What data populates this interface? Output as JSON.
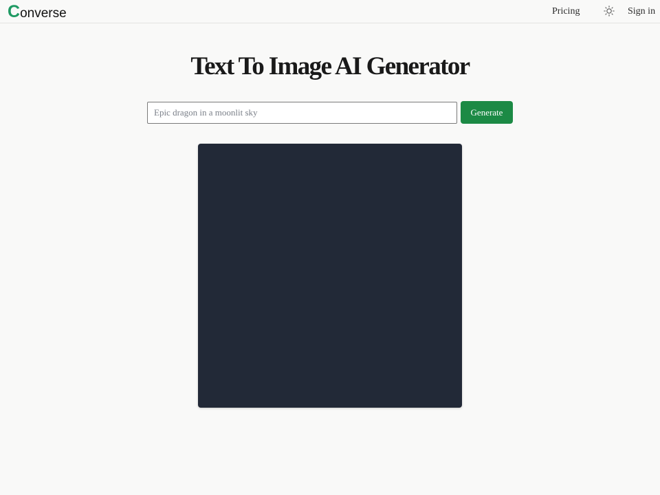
{
  "header": {
    "logo": {
      "mark": "C",
      "rest": "onverse"
    },
    "nav": {
      "pricing_label": "Pricing",
      "signin_label": "Sign in"
    },
    "theme_toggle_icon": "sun-icon"
  },
  "main": {
    "title": "Text To Image AI Generator",
    "prompt": {
      "value": "",
      "placeholder": "Epic dragon in a moonlit sky"
    },
    "generate_label": "Generate"
  },
  "colors": {
    "brand": "#1f9a63",
    "button": "#1c8a45",
    "image_placeholder": "#222937",
    "background": "#f9f9f8"
  }
}
